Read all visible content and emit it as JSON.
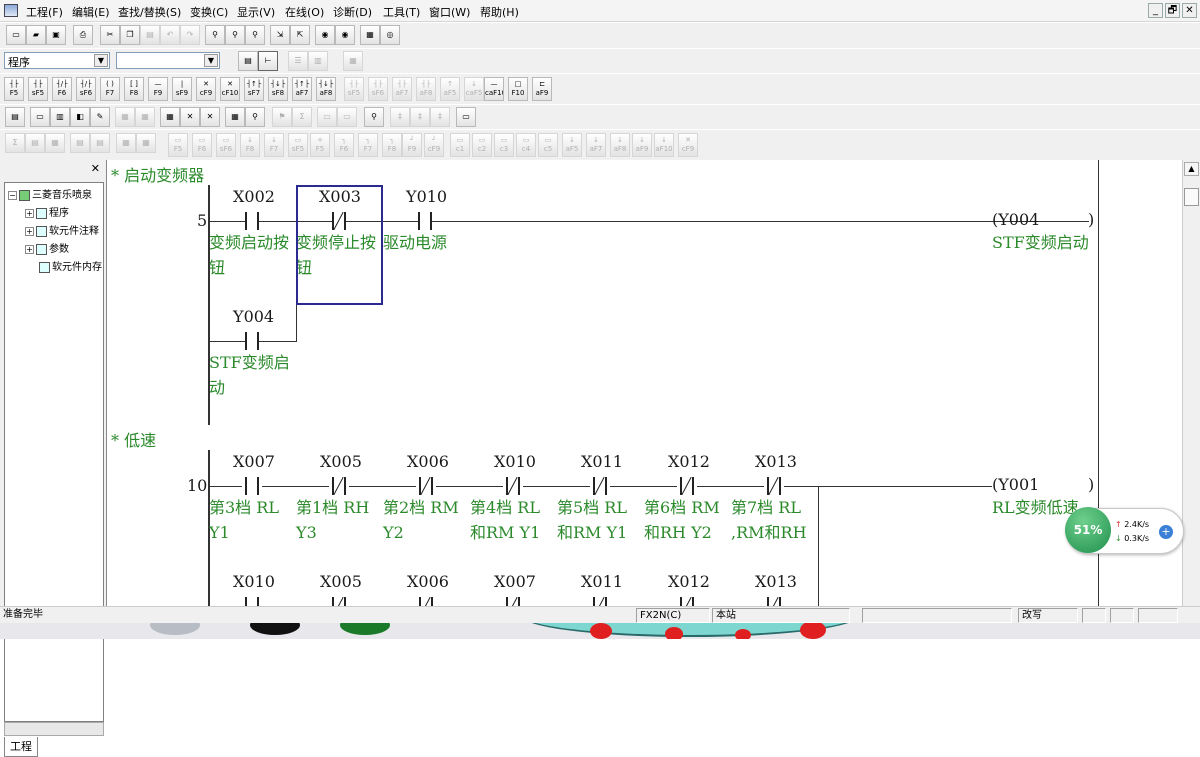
{
  "menu": [
    "工程(F)",
    "编辑(E)",
    "查找/替换(S)",
    "变换(C)",
    "显示(V)",
    "在线(O)",
    "诊断(D)",
    "工具(T)",
    "窗口(W)",
    "帮助(H)"
  ],
  "window_controls": [
    "_",
    "🗗",
    "✕"
  ],
  "toolbar": {
    "combo1_value": "程序",
    "combo2_value": "",
    "row3_labels": [
      "F5",
      "sF5",
      "F6",
      "sF6",
      "F7",
      "F8",
      "F9",
      "sF9",
      "cF9",
      "cF10",
      "sF7",
      "sF8",
      "aF7",
      "aF8",
      "aF5",
      "caF5",
      "caF10",
      "F10",
      "aF9"
    ],
    "row5_labels": [
      "F5",
      "F6",
      "sF6",
      "F8",
      "F7",
      "sF5",
      "F5",
      "F6",
      "F7",
      "F8",
      "F9",
      "cF9",
      "c1",
      "c2",
      "c3",
      "c4",
      "c5",
      "aF5",
      "aF7",
      "aF8",
      "aF9",
      "aF10",
      "cF9"
    ]
  },
  "project_tree": {
    "root": "三菱音乐喷泉",
    "items": [
      "程序",
      "软元件注释",
      "参数",
      "软元件内存"
    ],
    "tab": "工程"
  },
  "ladder": {
    "comment1": "* 启动变频器",
    "comment2": "* 低速",
    "rung1": {
      "step": "5",
      "contacts": [
        {
          "addr": "X002",
          "type": "NO",
          "comment": "变频启动按钮"
        },
        {
          "addr": "X003",
          "type": "NC",
          "comment": "变频停止按钮"
        },
        {
          "addr": "Y010",
          "type": "NO",
          "comment": "驱动电源"
        }
      ],
      "branch": {
        "addr": "Y004",
        "type": "NO",
        "comment": "STF变频启动"
      },
      "coil": {
        "addr": "(Y004",
        "close": ")",
        "comment": "STF变频启动"
      }
    },
    "rung2": {
      "step": "10",
      "contacts": [
        {
          "addr": "X007",
          "type": "NO",
          "comment": "第3档 RL Y1"
        },
        {
          "addr": "X005",
          "type": "NC",
          "comment": "第1档 RH Y3"
        },
        {
          "addr": "X006",
          "type": "NC",
          "comment": "第2档 RM Y2"
        },
        {
          "addr": "X010",
          "type": "NC",
          "comment": "第4档 RL 和RM Y1"
        },
        {
          "addr": "X011",
          "type": "NC",
          "comment": "第5档 RL 和RM Y1"
        },
        {
          "addr": "X012",
          "type": "NC",
          "comment": "第6档 RM 和RH Y2"
        },
        {
          "addr": "X013",
          "type": "NC",
          "comment": "第7档 RL ,RM和RH"
        }
      ],
      "coil": {
        "addr": "(Y001",
        "close": ")",
        "comment": "RL变频低速"
      }
    },
    "rung3": {
      "contacts": [
        {
          "addr": "X010",
          "type": "NO"
        },
        {
          "addr": "X005",
          "type": "NC"
        },
        {
          "addr": "X006",
          "type": "NC"
        },
        {
          "addr": "X007",
          "type": "NC"
        },
        {
          "addr": "X011",
          "type": "NC"
        },
        {
          "addr": "X012",
          "type": "NC"
        },
        {
          "addr": "X013",
          "type": "NC"
        }
      ]
    }
  },
  "status": {
    "ready": "准备完毕",
    "plc": "FX2N(C)",
    "station": "本站",
    "mode": "改写"
  },
  "speed_widget": {
    "percent": "51%",
    "up": "2.4K/s",
    "down": "0.3K/s"
  }
}
